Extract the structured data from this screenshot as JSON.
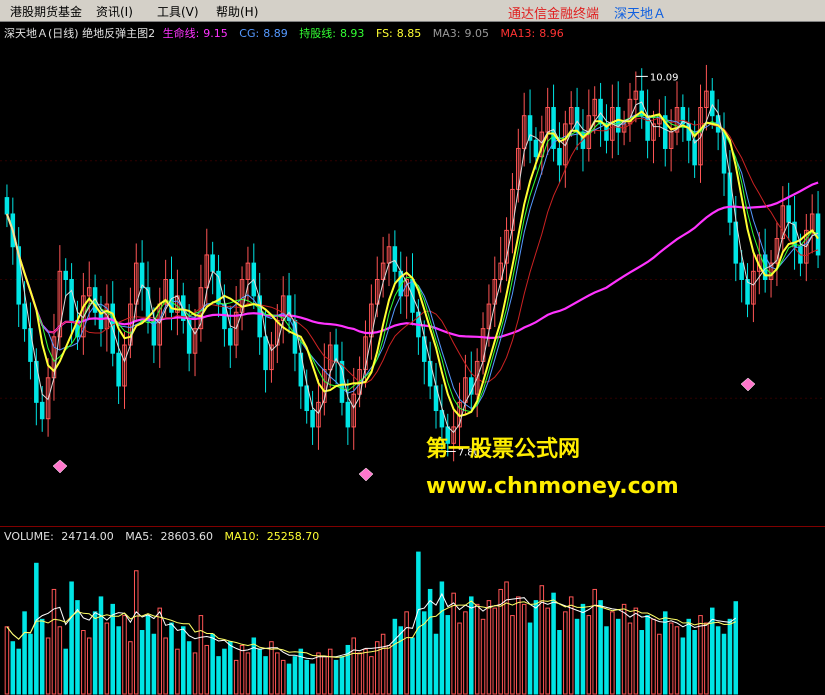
{
  "menubar": {
    "items": [
      "港股期货基金",
      "资讯(I)",
      "工具(V)",
      "帮助(H)"
    ],
    "brand": "通达信金融终端",
    "stock": "深天地Ａ"
  },
  "price_panel": {
    "title": "深天地Ａ(日线) 绝地反弹主图2",
    "indicators": [
      {
        "label": "生命线:",
        "value": "9.15",
        "color": "#ff33ff"
      },
      {
        "label": "CG:",
        "value": "8.89",
        "color": "#5599ff"
      },
      {
        "label": "持股线:",
        "value": "8.93",
        "color": "#33ff33"
      },
      {
        "label": "FS:",
        "value": "8.85",
        "color": "#ffff33"
      },
      {
        "label": "MA3:",
        "value": "9.05",
        "color": "#999999"
      },
      {
        "label": "MA13:",
        "value": "8.96",
        "color": "#ff3333"
      }
    ],
    "high_label": "10.09",
    "low_label": "7.80"
  },
  "volume_panel": {
    "label": "VOLUME:",
    "value": "24714.00",
    "ma5_label": "MA5:",
    "ma5_value": "28603.60",
    "ma10_label": "MA10:",
    "ma10_value": "25258.70"
  },
  "watermark": {
    "line1": "第一股票公式网",
    "line2": "www.chnmoney.com"
  },
  "colors": {
    "up": "#ff5555",
    "down": "#00e5e5",
    "life_line": "#ff33ff",
    "fs_line": "#ffff33",
    "cg_line": "#5599ff",
    "hold_line": "#33ff33",
    "ma13": "#cc2222",
    "grid": "#800000"
  },
  "chart_data": {
    "type": "candlestick",
    "closes": [
      9.25,
      9.05,
      8.7,
      8.55,
      8.35,
      8.1,
      8.0,
      8.25,
      8.5,
      8.9,
      8.85,
      8.6,
      8.5,
      8.75,
      8.8,
      8.65,
      8.55,
      8.7,
      8.4,
      8.2,
      8.45,
      8.7,
      8.95,
      8.8,
      8.6,
      8.45,
      8.7,
      8.85,
      8.65,
      8.75,
      8.6,
      8.4,
      8.55,
      8.8,
      9.0,
      8.9,
      8.7,
      8.55,
      8.45,
      8.65,
      8.85,
      8.95,
      8.75,
      8.5,
      8.3,
      8.45,
      8.6,
      8.75,
      8.6,
      8.4,
      8.2,
      8.05,
      7.95,
      8.1,
      8.3,
      8.45,
      8.35,
      8.1,
      7.95,
      8.15,
      8.3,
      8.5,
      8.7,
      8.85,
      8.95,
      9.05,
      8.9,
      8.75,
      8.85,
      8.65,
      8.5,
      8.35,
      8.2,
      8.05,
      7.95,
      7.85,
      7.95,
      8.1,
      8.25,
      8.15,
      8.35,
      8.55,
      8.7,
      8.85,
      8.95,
      9.15,
      9.4,
      9.65,
      9.85,
      9.7,
      9.6,
      9.75,
      9.9,
      9.65,
      9.55,
      9.8,
      9.9,
      9.75,
      9.65,
      9.85,
      9.95,
      9.8,
      9.7,
      9.9,
      9.75,
      9.8,
      9.95,
      10.0,
      9.85,
      9.7,
      9.8,
      9.85,
      9.65,
      9.75,
      9.9,
      9.8,
      9.7,
      9.55,
      9.9,
      10.0,
      9.85,
      9.75,
      9.5,
      9.2,
      8.95,
      8.85,
      8.7,
      8.9,
      9.0,
      8.85,
      8.95,
      9.1,
      9.3,
      9.2,
      9.05,
      8.95,
      9.15,
      9.25,
      9.0
    ],
    "volume": [
      18000,
      14000,
      12000,
      22000,
      16000,
      35000,
      20000,
      15000,
      28000,
      18000,
      12000,
      30000,
      25000,
      17000,
      15000,
      22000,
      26000,
      19000,
      24000,
      18000,
      21000,
      14000,
      33000,
      17000,
      21000,
      16000,
      23000,
      15000,
      19000,
      12000,
      18000,
      14000,
      11000,
      21000,
      13000,
      16000,
      10000,
      12000,
      14000,
      9000,
      13000,
      11000,
      15000,
      12000,
      10000,
      14000,
      11000,
      9000,
      8000,
      10000,
      12000,
      9000,
      8000,
      11000,
      10000,
      12000,
      9000,
      10000,
      13000,
      15000,
      11000,
      12000,
      10000,
      14000,
      16000,
      13000,
      20000,
      18000,
      22000,
      15000,
      38000,
      22000,
      28000,
      16000,
      30000,
      21000,
      27000,
      19000,
      22000,
      26000,
      24000,
      20000,
      25000,
      23000,
      28000,
      30000,
      21000,
      26000,
      24000,
      19000,
      25000,
      29000,
      23000,
      27000,
      17000,
      22000,
      26000,
      20000,
      24000,
      21000,
      28000,
      25000,
      18000,
      22000,
      20000,
      24000,
      19000,
      23000,
      17000,
      21000,
      20000,
      16000,
      22000,
      19000,
      18000,
      15000,
      20000,
      17000,
      21000,
      19000,
      23000,
      18000,
      16000,
      20000,
      24714
    ],
    "ylim": [
      7.4,
      10.3
    ],
    "high": 10.09,
    "low": 7.8
  }
}
